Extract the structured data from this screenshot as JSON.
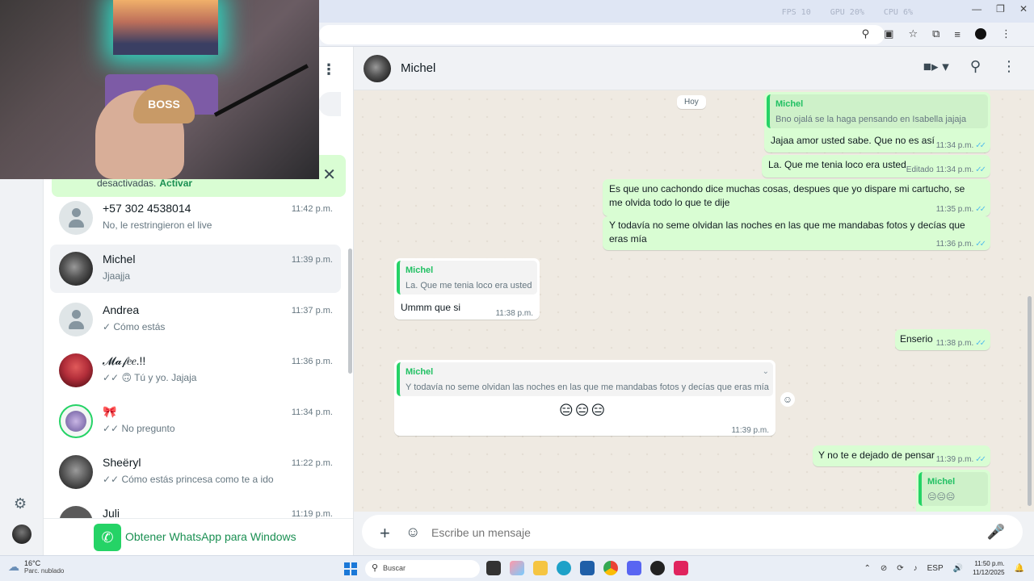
{
  "browser": {
    "perf": [
      "FPS 10",
      "GPU 20%",
      "CPU 6%"
    ],
    "window_controls": [
      "—",
      "❐",
      "✕"
    ],
    "toolbar_icons": [
      "zoom-icon",
      "cast-icon",
      "star-icon",
      "extensions-icon",
      "media-icon",
      "profile-icon",
      "menu-icon"
    ]
  },
  "webcam": {
    "cap_text": "BOSS"
  },
  "list": {
    "menu_icon": "⋮",
    "notification": {
      "text": "desactivadas.",
      "action": "Activar"
    },
    "chats": [
      {
        "name": "+57 302 4538014",
        "time": "11:42 p.m.",
        "preview": "No, le restringieron el live",
        "avatar": "default"
      },
      {
        "name": "Michel",
        "time": "11:39 p.m.",
        "preview": "Jjaajja",
        "avatar": "michel",
        "active": true
      },
      {
        "name": "Andrea",
        "time": "11:37 p.m.",
        "preview": "✓ Cómo estás",
        "avatar": "default"
      },
      {
        "name": "𝓜𝓪𝒻𝑒𝑒.!!",
        "time": "11:36 p.m.",
        "preview": "✓✓ 🙃 Tú y yo. Jajaja",
        "avatar": "mafe"
      },
      {
        "name": "🎀",
        "time": "11:34 p.m.",
        "preview": "✓✓ No pregunto",
        "avatar": "bow"
      },
      {
        "name": "Sheëryl",
        "time": "11:22 p.m.",
        "preview": "✓✓ Cómo estás princesa como te a ido",
        "avatar": "sheer"
      },
      {
        "name": "Juli",
        "time": "11:19 p.m.",
        "preview": "",
        "avatar": "juli"
      }
    ],
    "get_whatsapp": "Obtener WhatsApp para Windows"
  },
  "conversation": {
    "contact_name": "Michel",
    "day_label": "Hoy",
    "messages": [
      {
        "dir": "out",
        "quote_name": "Michel",
        "quote_text": "Bno ojalá se la haga pensando en Isabella jajaja",
        "text": "Jajaa amor usted sabe.  Que no es así",
        "time": "11:34 p.m."
      },
      {
        "dir": "out",
        "text": "La. Que me tenia loco era usted",
        "edited": "Editado",
        "time": "11:34 p.m."
      },
      {
        "dir": "out",
        "text": "Es que uno cachondo dice muchas cosas, despues que yo dispare mi cartucho, se me olvida todo lo que te dije",
        "time": "11:35 p.m."
      },
      {
        "dir": "out",
        "text": "Y todavía no seme olvidan las noches en las que me mandabas fotos y decías que eras mía",
        "time": "11:36 p.m."
      },
      {
        "dir": "in",
        "quote_name": "Michel",
        "quote_text": "La. Que me tenia loco era usted",
        "text": "Ummm que si",
        "time": "11:38 p.m."
      },
      {
        "dir": "out",
        "text": "Enserio",
        "time": "11:38 p.m."
      },
      {
        "dir": "in",
        "quote_name": "Michel",
        "quote_text": "Y todavía no seme olvidan las noches en las que me mandabas fotos y decías que eras mía",
        "text": "😑😑😑",
        "time": "11:39 p.m."
      },
      {
        "dir": "out",
        "text": "Y no te e dejado de pensar",
        "time": "11:39 p.m."
      },
      {
        "dir": "out",
        "quote_name": "Michel",
        "quote_text": "😑😑😑",
        "text": "",
        "time": ""
      }
    ],
    "composer_placeholder": "Escribe un mensaje"
  },
  "taskbar": {
    "temp": "16°C",
    "weather": "Parc. nublado",
    "search": "Buscar",
    "lang": "ESP",
    "time": "11:50 p.m.",
    "date": "11/12/2025"
  },
  "colors": {
    "accent": "#25d366",
    "outgoing_bubble": "#d9fdd3",
    "read_ticks": "#53bdeb",
    "quote_name": "#21c063"
  }
}
